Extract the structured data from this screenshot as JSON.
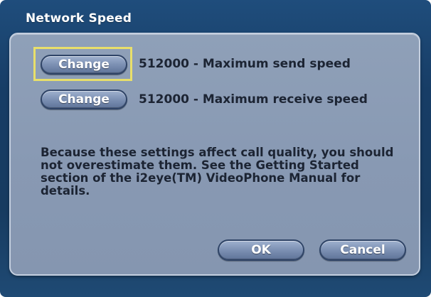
{
  "dialog": {
    "title": "Network Speed"
  },
  "send_speed": {
    "button_label": "Change",
    "value": "512000",
    "separator": "-",
    "description": "Maximum send speed"
  },
  "receive_speed": {
    "button_label": "Change",
    "value": "512000",
    "separator": "-",
    "description": "Maximum receive speed"
  },
  "note": {
    "text": "Because these settings affect call quality, you should\nnot overestimate them.  See the Getting Started\nsection of the i2eye(TM) VideoPhone Manual for\ndetails."
  },
  "footer": {
    "ok_label": "OK",
    "cancel_label": "Cancel"
  },
  "colors": {
    "frame": "#173d66",
    "panel": "#8a9bb4",
    "focus": "#e8df6a",
    "text": "#1c2433"
  }
}
